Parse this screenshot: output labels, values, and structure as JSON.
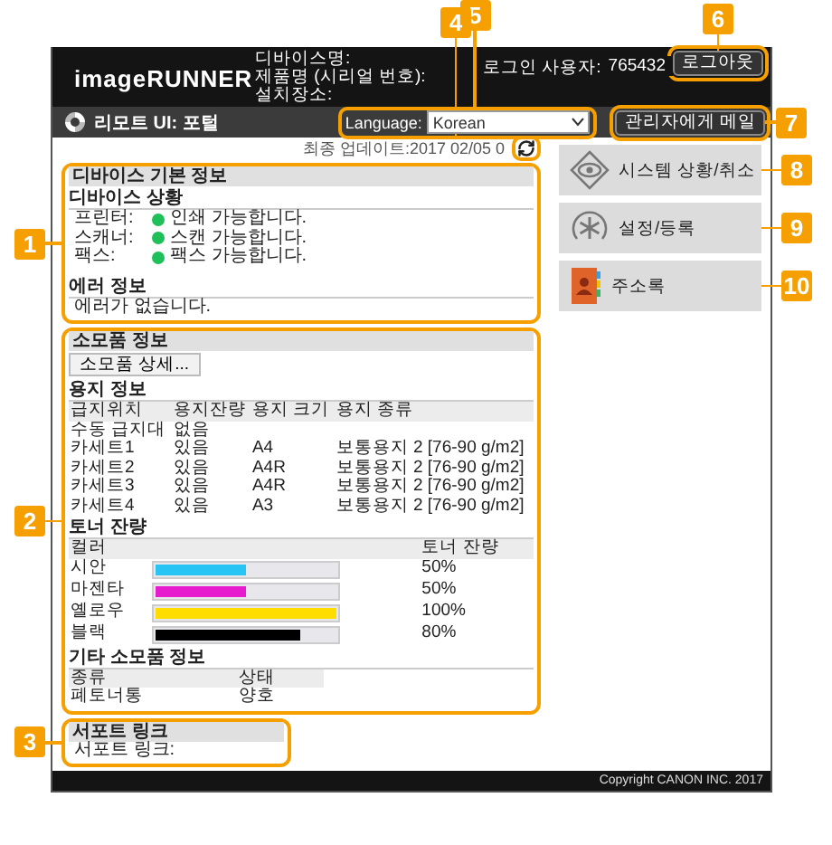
{
  "header": {
    "logo": "imageRUNNER",
    "device_labels": [
      "디바이스명:",
      "제품명 (시리얼 번호):",
      "설치장소:"
    ],
    "login_label": "로그인 사용자:",
    "login_user": "765432",
    "logout_button": "로그아웃"
  },
  "subheader": {
    "title": "리모트 UI: 포털",
    "language_label": "Language:",
    "language_value": "Korean",
    "mail_button": "관리자에게 메일"
  },
  "last_update": "최종 업데이트:2017 02/05 0",
  "device_info": {
    "title": "디바이스 기본 정보",
    "status_title": "디바이스 상황",
    "statuses": [
      {
        "label": "프린터:",
        "text": "인쇄 가능합니다.",
        "color": "#1fbf5a"
      },
      {
        "label": "스캐너:",
        "text": "스캔 가능합니다.",
        "color": "#1fbf5a"
      },
      {
        "label": "팩스:",
        "text": "팩스 가능합니다.",
        "color": "#1fbf5a"
      }
    ],
    "error_title": "에러 정보",
    "error_text": "에러가 없습니다."
  },
  "consumables": {
    "title": "소모품 정보",
    "details_button": "소모품 상세...",
    "paper_title": "용지 정보",
    "paper_columns": [
      "급지위치",
      "용지잔량",
      "용지 크기",
      "용지 종류"
    ],
    "paper_rows": [
      [
        "수동 급지대",
        "없음"
      ],
      [
        "카세트1",
        "있음",
        "A4",
        "보통용지 2 [76-90 g/m2]"
      ],
      [
        "카세트2",
        "있음",
        "A4R",
        "보통용지 2 [76-90 g/m2]"
      ],
      [
        "카세트3",
        "있음",
        "A4R",
        "보통용지 2 [76-90 g/m2]"
      ],
      [
        "카세트4",
        "있음",
        "A3",
        "보통용지 2 [76-90 g/m2]"
      ]
    ],
    "toner_title": "토너 잔량",
    "toner_columns": [
      "컬러",
      "토너 잔량"
    ],
    "toners": [
      {
        "name": "시안",
        "color": "#28c4f4",
        "level": 0.5,
        "reading": "50%"
      },
      {
        "name": "마젠타",
        "color": "#e81ccf",
        "level": 0.5,
        "reading": "50%"
      },
      {
        "name": "옐로우",
        "color": "#ffdd00",
        "level": 1,
        "reading": "100%"
      },
      {
        "name": "블랙",
        "color": "#000000",
        "level": 0.8,
        "reading": "80%"
      }
    ],
    "other_title": "기타 소모품 정보",
    "other_columns": [
      "종류",
      "상태"
    ],
    "other_rows": [
      [
        "폐토너통",
        "양호"
      ]
    ]
  },
  "support": {
    "title": "서포트 링크",
    "link_label": "서포트 링크:"
  },
  "menu": [
    {
      "label": "시스템 상황/취소",
      "kind": "eye"
    },
    {
      "label": "설정/등록",
      "kind": "gear"
    },
    {
      "label": "주소록",
      "kind": "book"
    }
  ],
  "footer": {
    "copyright": "Copyright CANON INC. 2017"
  },
  "callouts": [
    "1",
    "2",
    "3",
    "4",
    "5",
    "6",
    "7",
    "8",
    "9",
    "10"
  ]
}
